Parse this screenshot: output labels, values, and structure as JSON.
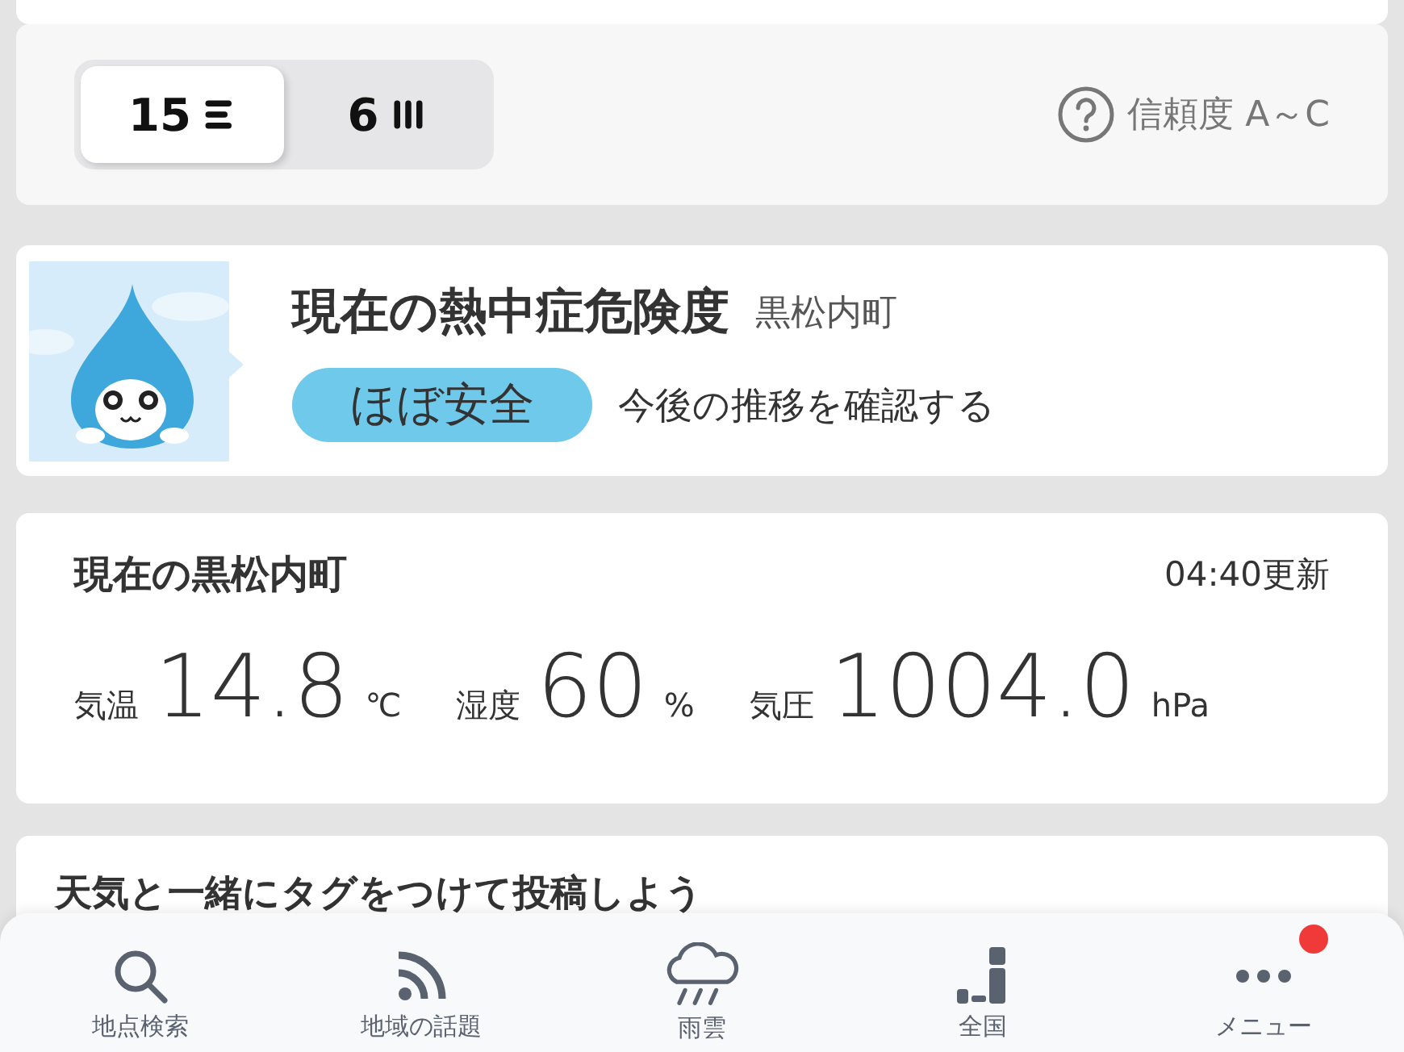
{
  "forecast_toggle": {
    "options": [
      {
        "label": "15",
        "kind": "list",
        "selected": true
      },
      {
        "label": "6",
        "kind": "columns",
        "selected": false
      }
    ],
    "reliability_link": "信頼度 A～C"
  },
  "heatstroke": {
    "title": "現在の熱中症危険度",
    "place": "黒松内町",
    "level_badge": "ほぼ安全",
    "trend_link": "今後の推移を確認する"
  },
  "current": {
    "title": "現在の黒松内町",
    "updated": "04:40更新",
    "readings": [
      {
        "label": "気温",
        "value": "14.8",
        "unit": "℃"
      },
      {
        "label": "湿度",
        "value": "60",
        "unit": "%"
      },
      {
        "label": "気圧",
        "value": "1004.0",
        "unit": "hPa"
      }
    ]
  },
  "post_card": {
    "title": "天気と一緒にタグをつけて投稿しよう"
  },
  "bottom_nav": [
    {
      "kind": "search",
      "label": "地点検索",
      "badge": false
    },
    {
      "kind": "feed",
      "label": "地域の話題",
      "badge": false
    },
    {
      "kind": "rain",
      "label": "雨雲",
      "badge": false
    },
    {
      "kind": "nation",
      "label": "全国",
      "badge": false
    },
    {
      "kind": "menu",
      "label": "メニュー",
      "badge": true
    }
  ]
}
